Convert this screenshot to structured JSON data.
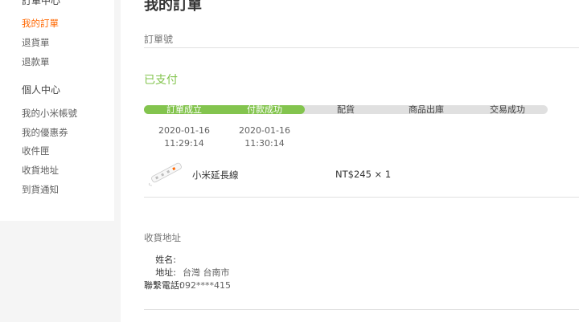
{
  "sidebar": {
    "order_center_title": "訂單中心",
    "order_items": [
      {
        "label": "我的訂單",
        "active": true
      },
      {
        "label": "退貨單",
        "active": false
      },
      {
        "label": "退款單",
        "active": false
      }
    ],
    "personal_center_title": "個人中心",
    "personal_items": [
      {
        "label": "我的小米帳號"
      },
      {
        "label": "我的優惠券"
      },
      {
        "label": "收件匣"
      },
      {
        "label": "收貨地址"
      },
      {
        "label": "到貨通知"
      }
    ]
  },
  "main": {
    "title": "我的訂單",
    "order_no_label": "訂單號",
    "status": "已支付",
    "steps": [
      {
        "label": "訂單成立",
        "done": true,
        "date": "2020-01-16",
        "time": "11:29:14"
      },
      {
        "label": "付款成功",
        "done": true,
        "date": "2020-01-16",
        "time": "11:30:14"
      },
      {
        "label": "配貨",
        "done": false
      },
      {
        "label": "商品出庫",
        "done": false
      },
      {
        "label": "交易成功",
        "done": false
      }
    ],
    "product": {
      "name": "小米延長線",
      "price": "NT$245 × 1"
    },
    "address": {
      "title": "收貨地址",
      "name_label": "姓名:",
      "name_value": "",
      "address_label": "地址:",
      "address_value": "台灣 台南市",
      "phone_label": "聯繫電話:",
      "phone_value": "092****415"
    }
  },
  "colors": {
    "accent_orange": "#ff6700",
    "status_green": "#83c44e",
    "progress_track": "#e0e0e0"
  }
}
